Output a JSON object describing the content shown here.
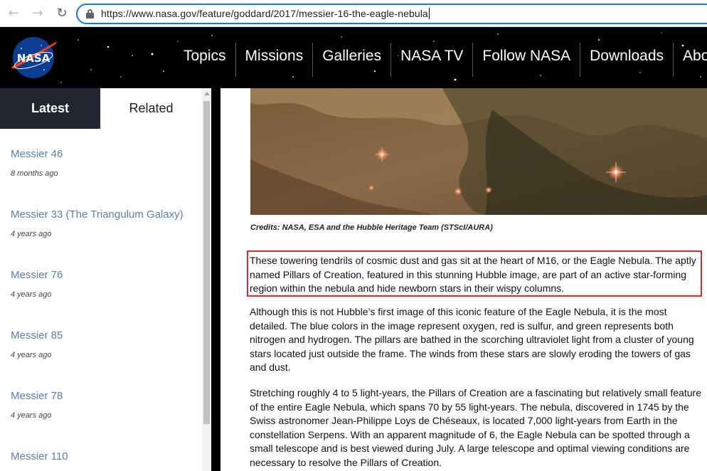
{
  "browser": {
    "url": "https://www.nasa.gov/feature/goddard/2017/messier-16-the-eagle-nebula",
    "back_icon": "arrow-left-icon",
    "forward_icon": "arrow-right-icon",
    "reload_icon": "reload-icon",
    "lock_icon": "lock-icon"
  },
  "header": {
    "logo_text": "NASA",
    "nav": [
      "Topics",
      "Missions",
      "Galleries",
      "NASA TV",
      "Follow NASA",
      "Downloads",
      "About"
    ]
  },
  "sidebar": {
    "tabs": {
      "latest": "Latest",
      "related": "Related"
    },
    "items": [
      {
        "title": "Messier 46",
        "ago": "8 months ago"
      },
      {
        "title": "Messier 33 (The Triangulum Galaxy)",
        "ago": "4 years ago"
      },
      {
        "title": "Messier 76",
        "ago": "4 years ago"
      },
      {
        "title": "Messier 85",
        "ago": "4 years ago"
      },
      {
        "title": "Messier 78",
        "ago": "4 years ago"
      },
      {
        "title": "Messier 110",
        "ago": ""
      }
    ]
  },
  "article": {
    "credit": "Credits: NASA, ESA and the Hubble Heritage Team (STScI/AURA)",
    "paragraphs": [
      "These towering tendrils of cosmic dust and gas sit at the heart of M16, or the Eagle Nebula. The aptly named Pillars of Creation, featured in this stunning Hubble image, are part of an active star-forming region within the nebula and hide newborn stars in their wispy columns.",
      "Although this is not Hubble’s first image of this iconic feature of the Eagle Nebula, it is the most detailed. The blue colors in the image represent oxygen, red is sulfur, and green represents both nitrogen and hydrogen. The pillars are bathed in the scorching ultraviolet light from a cluster of young stars located just outside the frame. The winds from these stars are slowly eroding the towers of gas and dust.",
      "Stretching roughly 4 to 5 light-years, the Pillars of Creation are a fascinating but relatively small feature of the entire Eagle Nebula, which spans 70 by 55 light-years. The nebula, discovered in 1745 by the Swiss astronomer Jean-Philippe Loys de Chéseaux, is located 7,000 light-years from Earth in the constellation Serpens. With an apparent magnitude of 6, the Eagle Nebula can be spotted through a small telescope and is best viewed during July. A large telescope and optimal viewing conditions are necessary to resolve the Pillars of Creation."
    ],
    "highlight_color": "#d32f2f"
  }
}
